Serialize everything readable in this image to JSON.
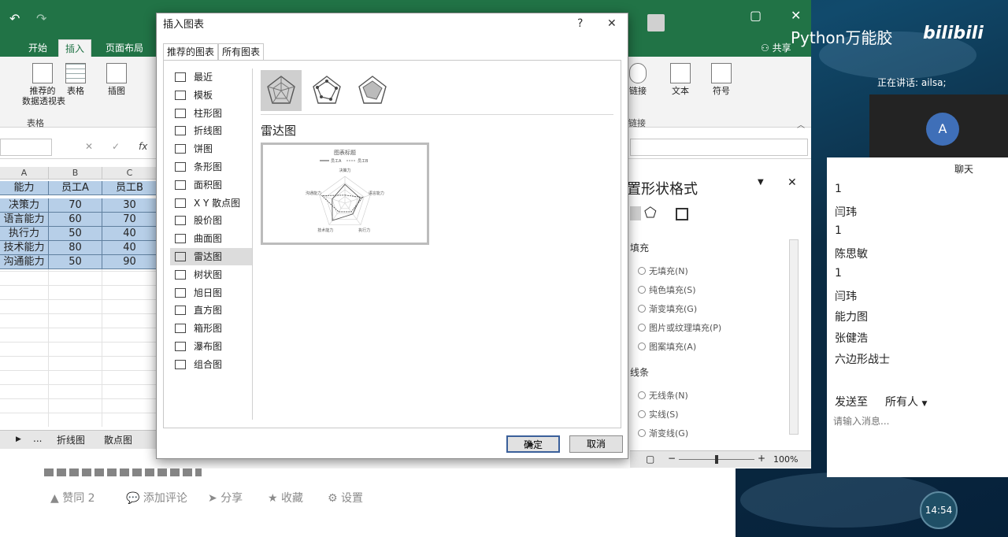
{
  "excel": {
    "tabs": [
      "开始",
      "插入",
      "页面布局"
    ],
    "active_tab": "插入",
    "share": "共享",
    "ribbon_left": {
      "recommended_pivot": "推荐的\n数据透视表",
      "table": "表格",
      "group_tables": "表格",
      "illustrations": "插图"
    },
    "ribbon_right": {
      "link": "链接",
      "text": "文本",
      "symbol": "符号",
      "group_links": "链接"
    },
    "formula_icons": {
      "cancel": "✕",
      "enter": "✓",
      "fx": "fx"
    },
    "columns": [
      "A",
      "B",
      "C"
    ],
    "header_row": [
      "能力",
      "员工A",
      "员工B"
    ],
    "rows": [
      [
        "决策力",
        "70",
        "30"
      ],
      [
        "语言能力",
        "60",
        "70"
      ],
      [
        "执行力",
        "50",
        "40"
      ],
      [
        "技术能力",
        "80",
        "40"
      ],
      [
        "沟通能力",
        "50",
        "90"
      ]
    ],
    "sheet_tabs": [
      "...",
      "折线图",
      "散点图"
    ],
    "zoom": "100%",
    "format_pane": {
      "title": "置形状格式",
      "fill_section": "填充",
      "fill_options": [
        "无填充(N)",
        "纯色填充(S)",
        "渐变填充(G)",
        "图片或纹理填充(P)",
        "图案填充(A)"
      ],
      "line_section": "线条",
      "line_options": [
        "无线条(N)",
        "实线(S)",
        "渐变线(G)"
      ]
    }
  },
  "dialog": {
    "title": "插入图表",
    "help": "?",
    "close": "✕",
    "tabs": [
      "推荐的图表",
      "所有图表"
    ],
    "active_tab": "所有图表",
    "chart_types": [
      "最近",
      "模板",
      "柱形图",
      "折线图",
      "饼图",
      "条形图",
      "面积图",
      "X Y 散点图",
      "股价图",
      "曲面图",
      "雷达图",
      "树状图",
      "旭日图",
      "直方图",
      "箱形图",
      "瀑布图",
      "组合图"
    ],
    "selected_type": "雷达图",
    "selected_variant": "雷达图",
    "preview": {
      "title": "图表标题",
      "legend": [
        "员工A",
        "员工B"
      ],
      "axes": [
        "决策力",
        "语言能力",
        "执行力",
        "技术能力",
        "沟通能力"
      ]
    },
    "ok": "确定",
    "cancel": "取消"
  },
  "watermark": "Python万能胶",
  "watermark_brand": "bilibili",
  "meeting": {
    "speaking": "正在讲话: ailsa;",
    "avatar_letter": "A",
    "chat_title": "聊天",
    "messages": [
      "1",
      "闫玮",
      "1",
      "陈思敏",
      "1",
      "闫玮",
      "能力图",
      "张健浩",
      "六边形战士"
    ],
    "send_to_label": "发送至",
    "send_to_value": "所有人",
    "input_placeholder": "请输入消息...",
    "clock": "14:54"
  },
  "article": {
    "buttons": [
      "赞同 2",
      "添加评论",
      "分享",
      "收藏",
      "设置"
    ]
  },
  "colors": {
    "excel_green": "#217346",
    "selection": "#b7cfe8",
    "chart_line": "#555555"
  }
}
